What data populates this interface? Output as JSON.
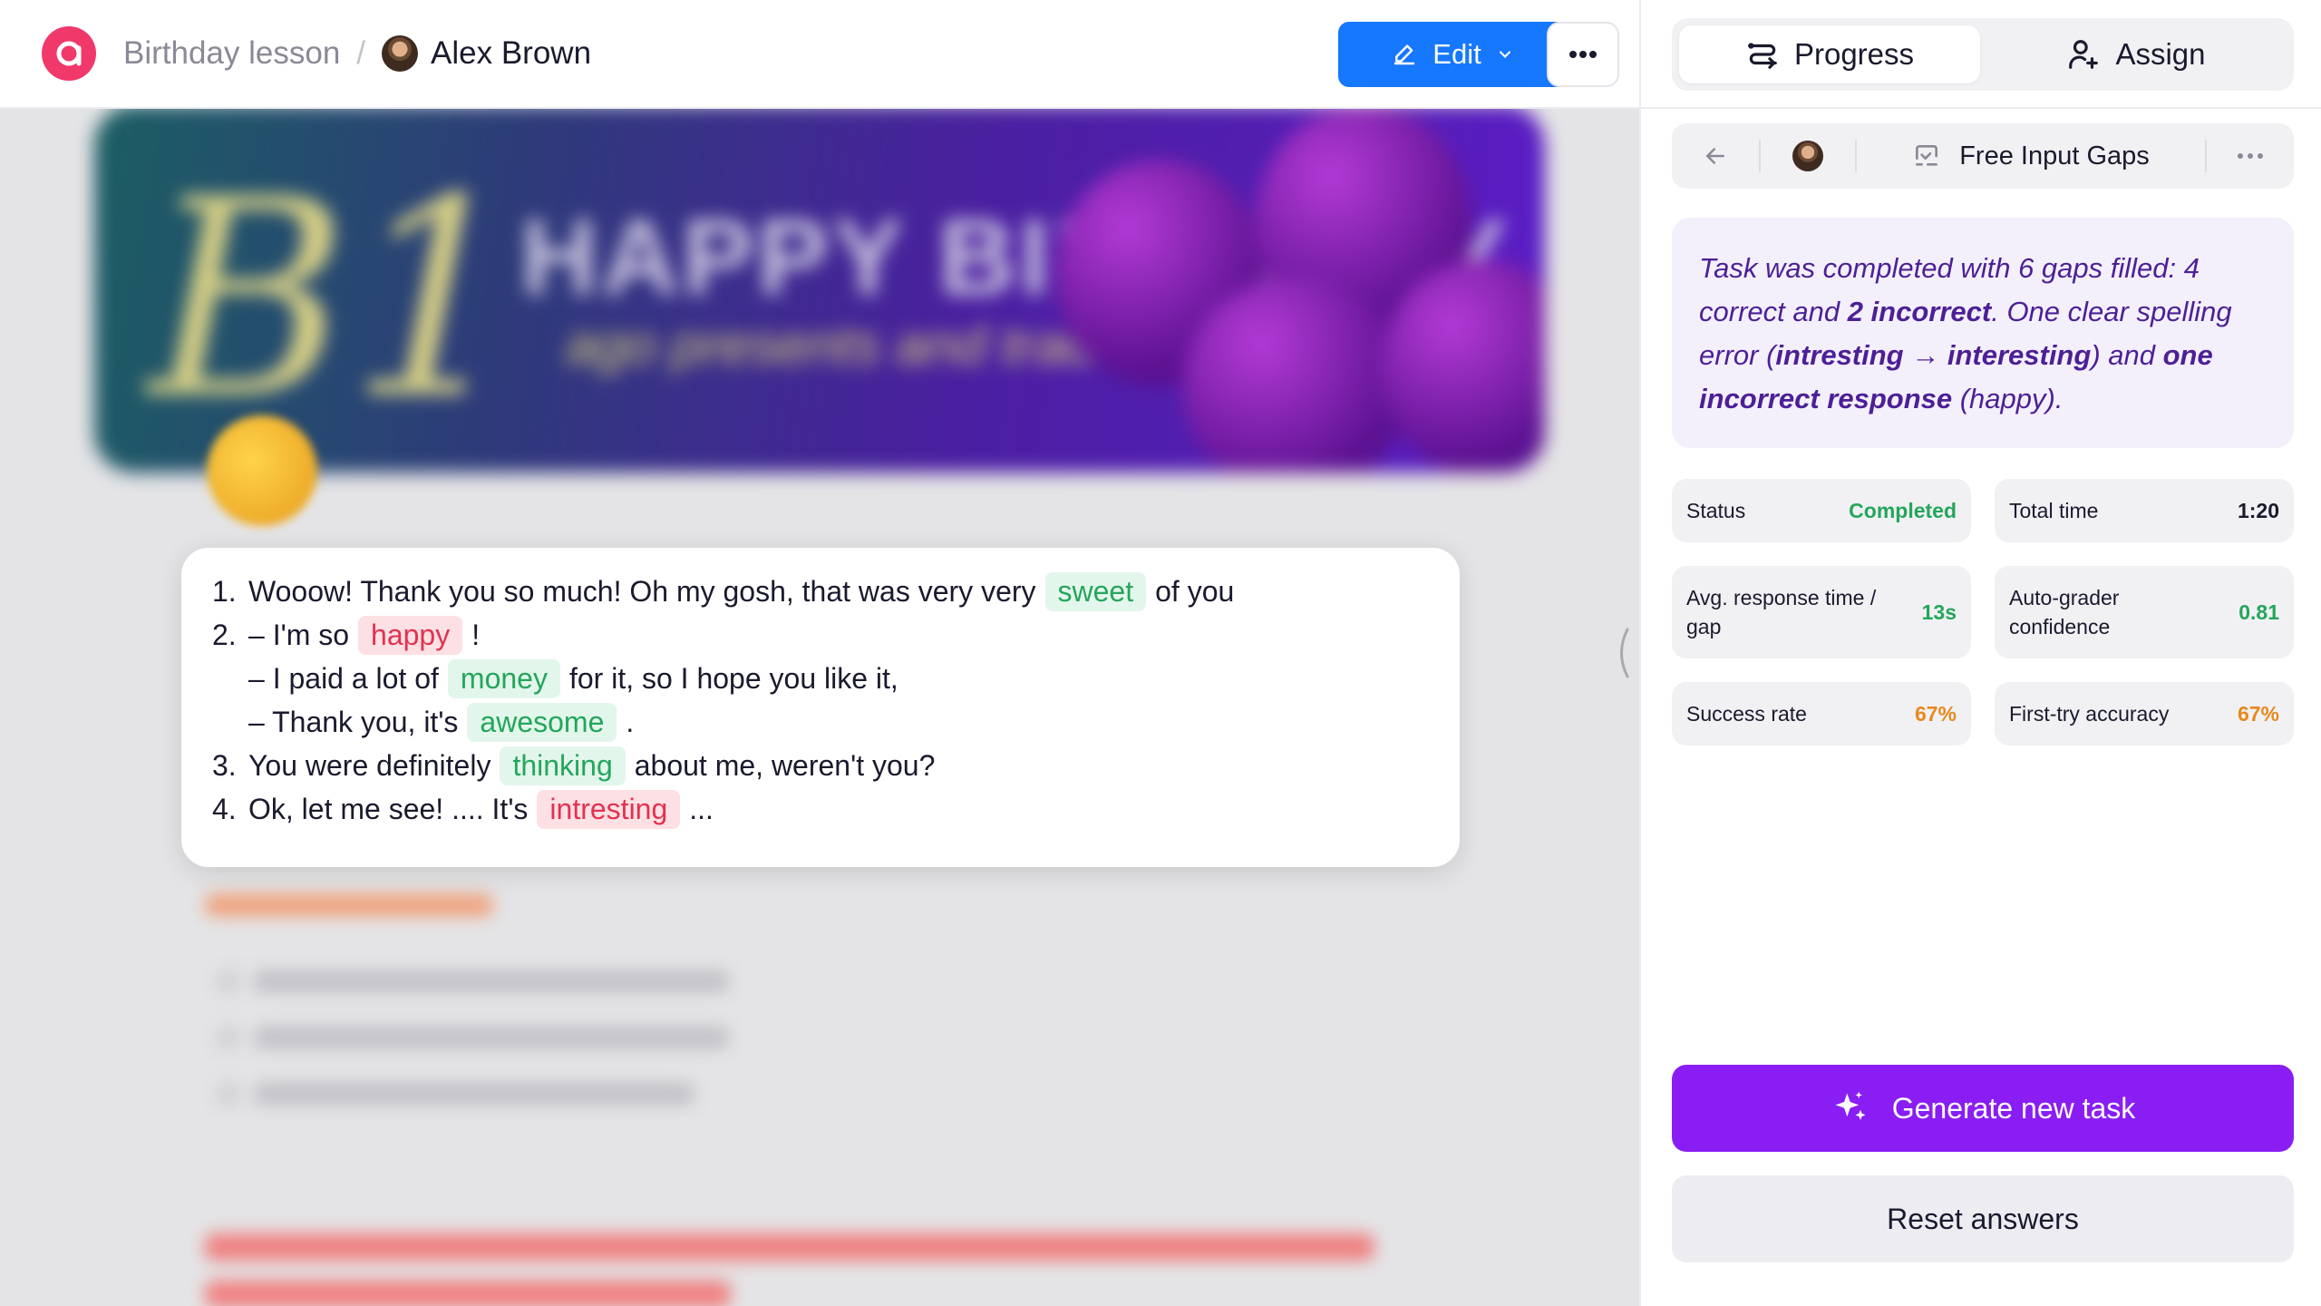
{
  "topbar": {
    "breadcrumb": "Birthday lesson",
    "separator": "/",
    "user_name": "Alex Brown",
    "edit_label": "Edit"
  },
  "exercise": {
    "lines": [
      {
        "num": "1.",
        "pre": "Wooow! Thank you so much! Oh my gosh, that was very very",
        "gap": "sweet",
        "gap_status": "correct",
        "post": "of you"
      },
      {
        "num": "2.",
        "pre": "– I'm so",
        "gap": "happy",
        "gap_status": "incorrect",
        "post": "!"
      },
      {
        "num": "",
        "pre": "– I paid a lot of",
        "gap": "money",
        "gap_status": "correct",
        "post": "for it, so I hope you like it,"
      },
      {
        "num": "",
        "pre": "– Thank you, it's",
        "gap": "awesome",
        "gap_status": "correct",
        "post": "."
      },
      {
        "num": "3.",
        "pre": "You were definitely",
        "gap": "thinking",
        "gap_status": "correct",
        "post": "about me, weren't you?"
      },
      {
        "num": "4.",
        "pre": "Ok, let me see! .... It's",
        "gap": "intresting",
        "gap_status": "incorrect",
        "post": "..."
      }
    ]
  },
  "right_panel": {
    "tabs": [
      {
        "label": "Progress",
        "active": true
      },
      {
        "label": "Assign",
        "active": false
      }
    ],
    "task_title": "Free Input Gaps",
    "summary": {
      "part1": "Task was completed with 6 gaps filled: 4 correct and ",
      "bold1": "2 incorrect",
      "part2": ". One clear spelling error (",
      "bold2": "intresting → interesting",
      "part3": ") and ",
      "bold3": "one incorrect response",
      "part4": " (happy)."
    },
    "stats": [
      {
        "label": "Status",
        "value": "Completed",
        "color": "#24a65b"
      },
      {
        "label": "Total time",
        "value": "1:20",
        "color": "#1a1a2e"
      },
      {
        "label": "Avg. response time / gap",
        "value": "13s",
        "color": "#24a65b"
      },
      {
        "label": "Auto-grader confidence",
        "value": "0.81",
        "color": "#24a65b"
      },
      {
        "label": "Success rate",
        "value": "67%",
        "color": "#e8891c"
      },
      {
        "label": "First-try accuracy",
        "value": "67%",
        "color": "#e8891c"
      }
    ],
    "generate_label": "Generate new task",
    "reset_label": "Reset answers"
  },
  "colors": {
    "accent": "#1677ff",
    "primary_purple": "#8a1df4",
    "correct": "#24a65b",
    "incorrect": "#e2324f",
    "warning": "#e8891c"
  }
}
